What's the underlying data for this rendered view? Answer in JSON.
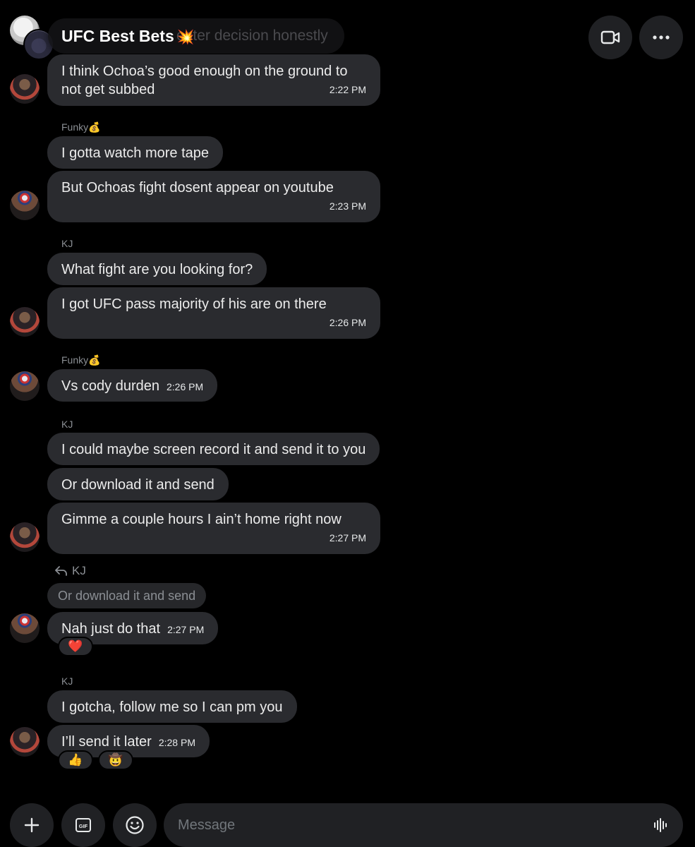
{
  "header": {
    "title": "UFC Best Bets",
    "title_emoji": "💥",
    "ghost_text": "enter decision honestly"
  },
  "icons": {
    "video": "video-camera-icon",
    "more": "more-horizontal-icon",
    "add": "plus-icon",
    "gif": "gif-icon",
    "emoji": "emoji-icon",
    "voice": "voice-wave-icon",
    "reply": "reply-arrow-icon"
  },
  "senders": {
    "funky": "Funky💰",
    "kj": "KJ"
  },
  "messages": [
    {
      "text_line1": "I think Ochoa’s good enough on the ground to",
      "text_line2": "not get subbed",
      "time": "2:22 PM"
    },
    {
      "text": "I gotta watch more tape"
    },
    {
      "text": "But Ochoas fight dosent appear on youtube",
      "time": "2:23 PM"
    },
    {
      "text": "What fight are you looking for?"
    },
    {
      "text": "I got UFC pass majority of his are on there",
      "time": "2:26 PM"
    },
    {
      "text": "Vs cody durden",
      "time": "2:26 PM"
    },
    {
      "text": "I could maybe screen record it and send it to you"
    },
    {
      "text": "Or download it and send"
    },
    {
      "text": "Gimme a couple hours I ain’t home right now",
      "time": "2:27 PM"
    },
    {
      "text": "Nah just do that",
      "time": "2:27 PM",
      "reaction": "❤️"
    },
    {
      "text": "I gotcha, follow me so I can pm you"
    },
    {
      "text": "I’ll send it later",
      "time": "2:28 PM",
      "reactions": [
        "👍",
        "🤠"
      ]
    }
  ],
  "reply": {
    "to": "KJ",
    "quoted": "Or download it and send"
  },
  "composer": {
    "placeholder": "Message"
  }
}
